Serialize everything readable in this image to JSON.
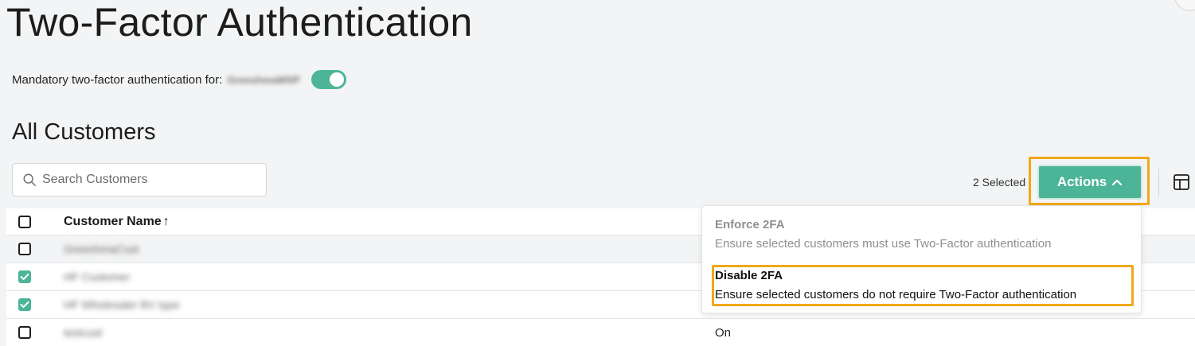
{
  "page": {
    "title": "Two-Factor Authentication"
  },
  "mandatory": {
    "label": "Mandatory two-factor authentication for:",
    "org_name": "GreeshmaMSP",
    "toggle_on": true
  },
  "section": {
    "title": "All Customers"
  },
  "search": {
    "placeholder": "Search Customers",
    "value": ""
  },
  "toolbar": {
    "selected_count_text": "2 Selected",
    "actions_label": "Actions"
  },
  "table": {
    "columns": [
      {
        "label": "Customer Name",
        "sort": "↑"
      }
    ],
    "rows": [
      {
        "name": "GreeshmaCust",
        "checked": false,
        "status": ""
      },
      {
        "name": "HF Customer",
        "checked": true,
        "status": ""
      },
      {
        "name": "HF Wholesaler BV type",
        "checked": true,
        "status": ""
      },
      {
        "name": "testcust",
        "checked": false,
        "status": "On"
      }
    ]
  },
  "actions_menu": {
    "items": [
      {
        "title": "Enforce 2FA",
        "description": "Ensure selected customers must use Two-Factor authentication",
        "enabled": false
      },
      {
        "title": "Disable 2FA",
        "description": "Ensure selected customers do not require Two-Factor authentication",
        "enabled": true
      }
    ]
  },
  "colors": {
    "accent": "#4db597",
    "highlight": "#f0a818"
  },
  "icons": {
    "search": "search-icon",
    "chevron": "chevron-up-icon",
    "columns": "table-columns-icon",
    "checkmark": "checkmark-icon",
    "sort": "sort-ascending-icon"
  }
}
